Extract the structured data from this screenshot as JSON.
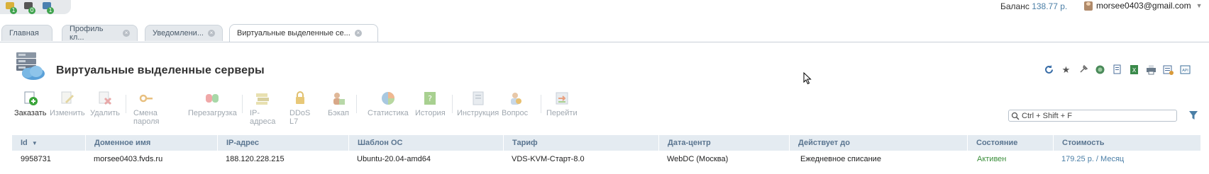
{
  "top": {
    "icons": [
      {
        "name": "mail-folder-icon",
        "badge": "1",
        "color": "#d9b13a"
      },
      {
        "name": "support-ticket-icon",
        "badge": "0",
        "color": "#555555"
      },
      {
        "name": "billing-document-icon",
        "badge": "1",
        "color": "#4a80b0"
      }
    ],
    "balance_label": "Баланс",
    "balance_value": "138.77 р.",
    "user_email": "morsee0403@gmail.com"
  },
  "tabs": [
    {
      "label": "Главная",
      "closable": false,
      "active": false
    },
    {
      "label": "Профиль кл...",
      "closable": true,
      "active": false
    },
    {
      "label": "Уведомлени...",
      "closable": true,
      "active": false
    },
    {
      "label": "Виртуальные выделенные се...",
      "closable": true,
      "active": true
    }
  ],
  "page": {
    "title": "Виртуальные выделенные серверы"
  },
  "right_tools": [
    "refresh-icon",
    "star-icon",
    "pin-icon",
    "globe-icon",
    "copy-icon",
    "excel-icon",
    "print-icon",
    "export-icon",
    "api-icon"
  ],
  "toolbar": [
    {
      "label": "Заказать",
      "enabled": true,
      "icon": "order-add-icon",
      "color": "#3aa53a"
    },
    {
      "label": "Изменить",
      "enabled": false,
      "icon": "edit-icon",
      "color": "#d8c890"
    },
    {
      "label": "Удалить",
      "enabled": false,
      "icon": "delete-icon",
      "color": "#e0a0a0"
    },
    {
      "label": "Смена пароля",
      "enabled": false,
      "icon": "key-icon",
      "color": "#e8c080"
    },
    {
      "label": "Перезагрузка",
      "enabled": false,
      "icon": "reboot-icon",
      "color": "#e89090"
    },
    {
      "label": "IP-адреса",
      "enabled": false,
      "icon": "ip-icon",
      "color": "#d8d0a0"
    },
    {
      "label": "DDoS L7",
      "enabled": false,
      "icon": "lock-icon",
      "color": "#e0c070"
    },
    {
      "label": "Бэкап",
      "enabled": false,
      "icon": "backup-icon",
      "color": "#d0a080"
    },
    {
      "label": "Статистика",
      "enabled": false,
      "icon": "stats-pie-icon",
      "color": "#e0a070"
    },
    {
      "label": "История",
      "enabled": false,
      "icon": "history-icon",
      "color": "#90c070"
    },
    {
      "label": "Инструкция",
      "enabled": false,
      "icon": "manual-icon",
      "color": "#c0c8d0"
    },
    {
      "label": "Вопрос",
      "enabled": false,
      "icon": "question-icon",
      "color": "#d0b090"
    },
    {
      "label": "Перейти",
      "enabled": false,
      "icon": "goto-icon",
      "color": "#c0c8b0"
    }
  ],
  "search": {
    "placeholder": "Ctrl + Shift + F"
  },
  "table": {
    "columns": [
      "Id",
      "Доменное имя",
      "IP-адрес",
      "Шаблон ОС",
      "Тариф",
      "Дата-центр",
      "Действует до",
      "Состояние",
      "Стоимость"
    ],
    "sort_indicator": "▼",
    "rows": [
      [
        "9958731",
        "morsee0403.fvds.ru",
        "188.120.228.215",
        "Ubuntu-20.04-amd64",
        "VDS-KVM-Старт-8.0",
        "WebDC (Москва)",
        "Ежедневное списание",
        "Активен",
        "179.25 р. / Месяц"
      ]
    ]
  }
}
